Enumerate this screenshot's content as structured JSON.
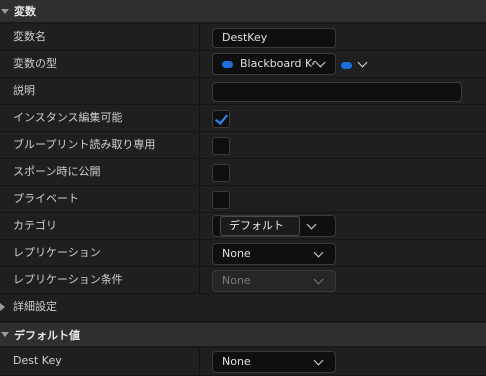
{
  "sections": {
    "variables_title": "変数",
    "default_value_title": "デフォルト値"
  },
  "rows": {
    "variable_name": {
      "label": "変数名",
      "value": "DestKey"
    },
    "variable_type": {
      "label": "変数の型",
      "value": "Blackboard Ke",
      "accent": "#1d6fe0"
    },
    "description": {
      "label": "説明",
      "value": ""
    },
    "instance_editable": {
      "label": "インスタンス編集可能",
      "checked": true
    },
    "blueprint_read_only": {
      "label": "ブループリント読み取り専用",
      "checked": false
    },
    "expose_on_spawn": {
      "label": "スポーン時に公開",
      "checked": false
    },
    "private": {
      "label": "プライベート",
      "checked": false
    },
    "category": {
      "label": "カテゴリ",
      "value": "",
      "tooltip": "デフォルト"
    },
    "replication": {
      "label": "レプリケーション",
      "value": "None"
    },
    "replication_condition": {
      "label": "レプリケーション条件",
      "value": "None"
    },
    "advanced": {
      "label": "詳細設定"
    },
    "dest_key": {
      "label": "Dest Key",
      "value": "None"
    }
  }
}
